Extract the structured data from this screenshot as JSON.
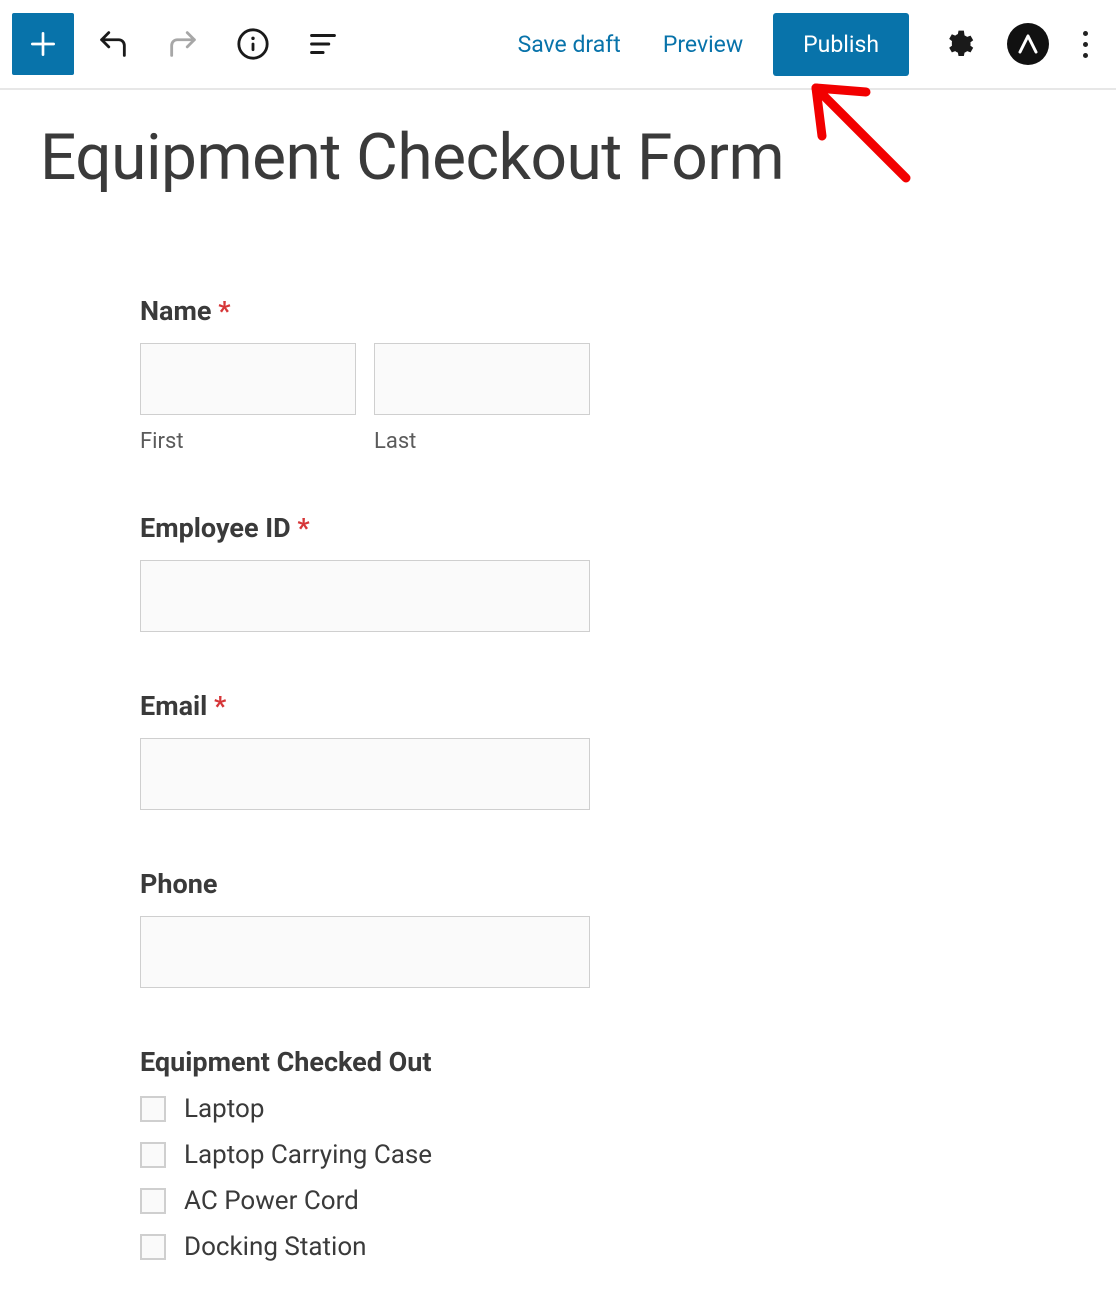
{
  "toolbar": {
    "save_draft_label": "Save draft",
    "preview_label": "Preview",
    "publish_label": "Publish"
  },
  "page": {
    "title": "Equipment Checkout Form"
  },
  "form": {
    "name": {
      "label": "Name",
      "required": "*",
      "first_sublabel": "First",
      "last_sublabel": "Last"
    },
    "employee_id": {
      "label": "Employee ID",
      "required": "*"
    },
    "email": {
      "label": "Email",
      "required": "*"
    },
    "phone": {
      "label": "Phone"
    },
    "equipment": {
      "label": "Equipment Checked Out",
      "options": {
        "0": "Laptop",
        "1": "Laptop Carrying Case",
        "2": "AC Power Cord",
        "3": "Docking Station"
      }
    }
  }
}
